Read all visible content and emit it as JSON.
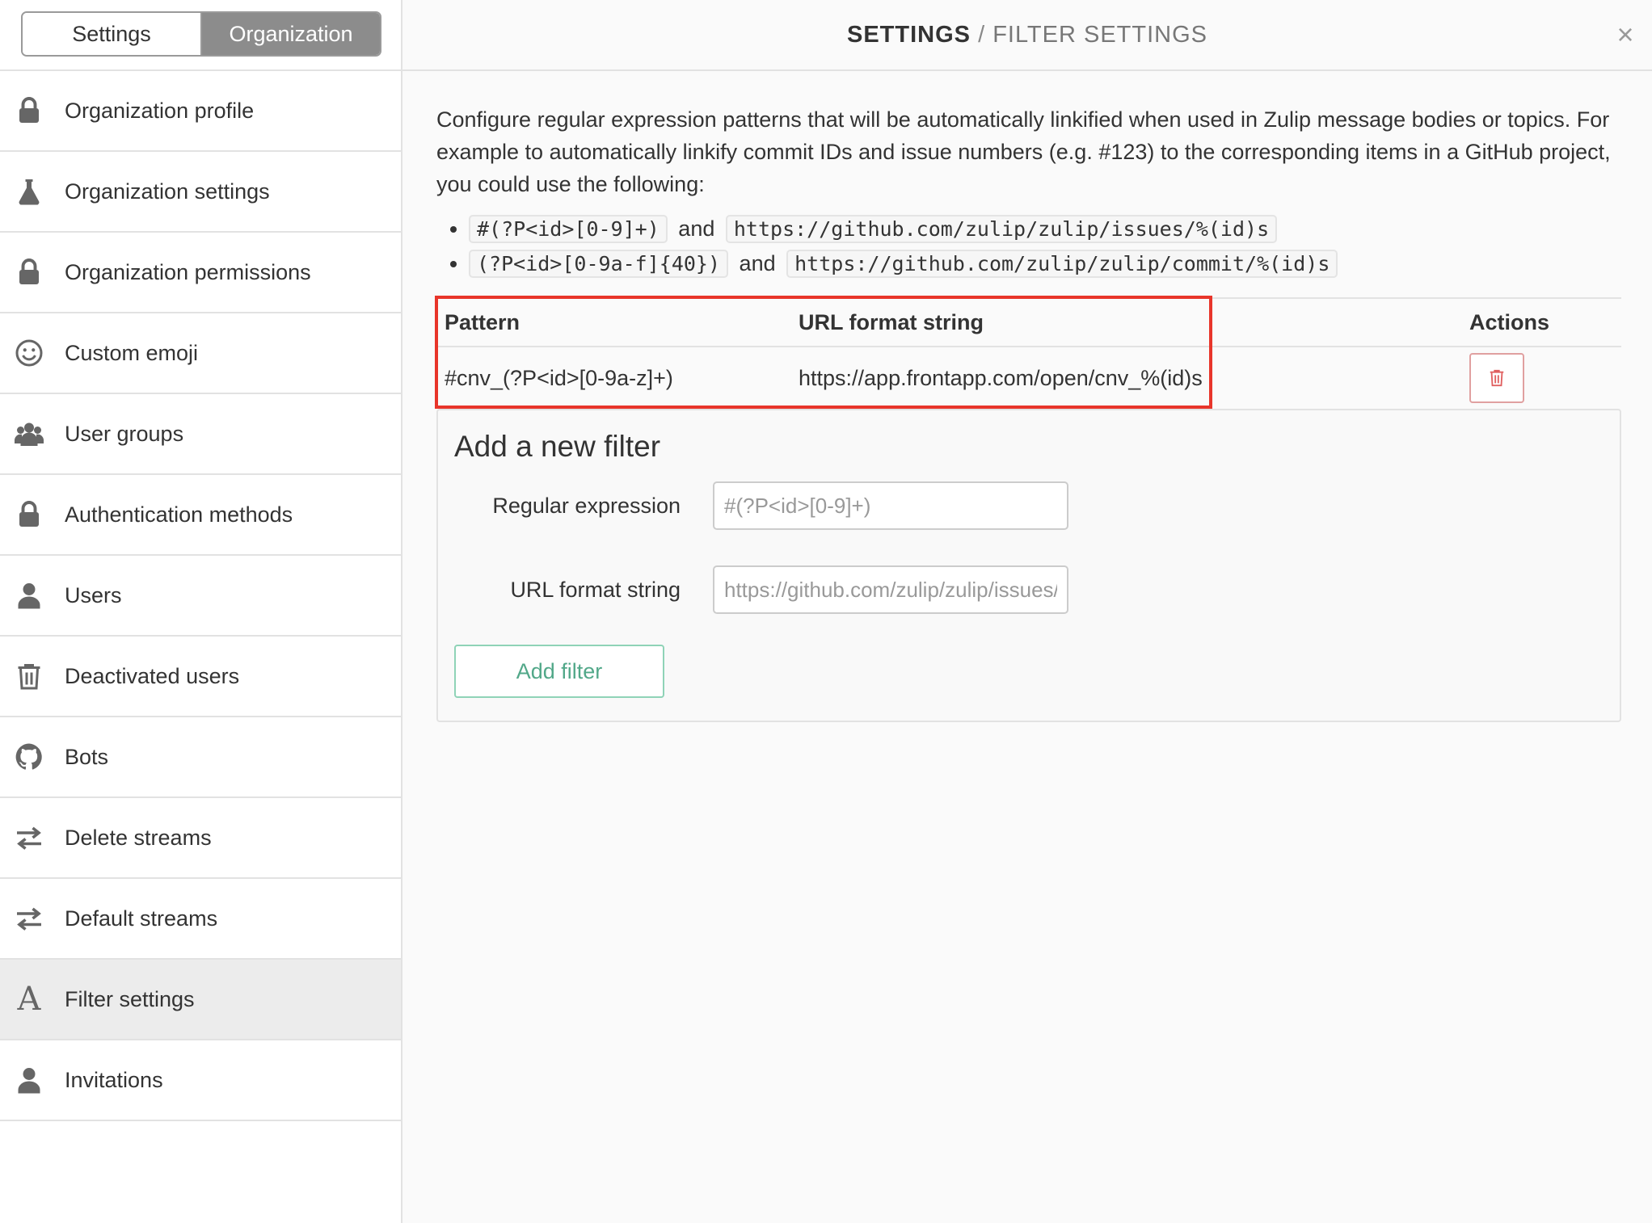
{
  "tabs": {
    "settings": "Settings",
    "organization": "Organization"
  },
  "sidebar": {
    "items": [
      {
        "label": "Organization profile",
        "icon": "lock-icon"
      },
      {
        "label": "Organization settings",
        "icon": "flask-icon"
      },
      {
        "label": "Organization permissions",
        "icon": "lock-icon"
      },
      {
        "label": "Custom emoji",
        "icon": "smiley-icon"
      },
      {
        "label": "User groups",
        "icon": "users-icon"
      },
      {
        "label": "Authentication methods",
        "icon": "lock-icon"
      },
      {
        "label": "Users",
        "icon": "user-icon"
      },
      {
        "label": "Deactivated users",
        "icon": "trash-icon"
      },
      {
        "label": "Bots",
        "icon": "github-icon"
      },
      {
        "label": "Delete streams",
        "icon": "exchange-icon"
      },
      {
        "label": "Default streams",
        "icon": "exchange-icon"
      },
      {
        "label": "Filter settings",
        "icon": "font-icon",
        "glyph": "A"
      },
      {
        "label": "Invitations",
        "icon": "user-icon"
      }
    ],
    "active": "Filter settings"
  },
  "header": {
    "title_strong": "SETTINGS",
    "separator": "/",
    "title_sub": "FILTER SETTINGS",
    "close": "×"
  },
  "main": {
    "description": "Configure regular expression patterns that will be automatically linkified when used in Zulip message bodies or topics. For example to automatically linkify commit IDs and issue numbers (e.g. #123) to the corresponding items in a GitHub project, you could use the following:",
    "examples": [
      {
        "pattern": "#(?P<id>[0-9]+)",
        "conj": "and",
        "url": "https://github.com/zulip/zulip/issues/%(id)s"
      },
      {
        "pattern": "(?P<id>[0-9a-f]{40})",
        "conj": "and",
        "url": "https://github.com/zulip/zulip/commit/%(id)s"
      }
    ],
    "table": {
      "headers": {
        "pattern": "Pattern",
        "url": "URL format string",
        "actions": "Actions"
      },
      "rows": [
        {
          "pattern": "#cnv_(?P<id>[0-9a-z]+)",
          "url": "https://app.frontapp.com/open/cnv_%(id)s"
        }
      ]
    },
    "add_form": {
      "heading": "Add a new filter",
      "regex_label": "Regular expression",
      "regex_placeholder": "#(?P<id>[0-9]+)",
      "url_label": "URL format string",
      "url_placeholder": "https://github.com/zulip/zulip/issues/%(id)s",
      "submit": "Add filter"
    }
  },
  "colors": {
    "highlight": "#e8352a",
    "accent_green": "#52a889",
    "delete_red": "#e0a0a0"
  }
}
